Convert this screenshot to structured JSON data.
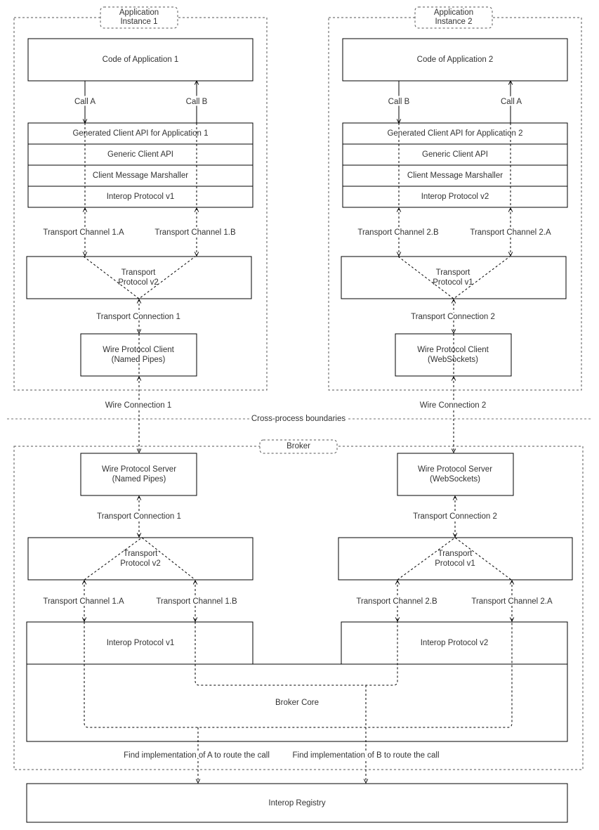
{
  "app1": {
    "group_label": [
      "Application",
      "Instance 1"
    ],
    "code": "Code of Application 1",
    "call_down": "Call A",
    "call_up": "Call B",
    "stack": [
      "Generated Client API for Application 1",
      "Generic Client API",
      "Client Message Marshaller",
      "Interop Protocol v1"
    ],
    "channel_left": "Transport Channel 1.A",
    "channel_right": "Transport Channel 1.B",
    "transport": [
      "Transport",
      "Protocol v2"
    ],
    "connection": "Transport Connection 1",
    "wire_client": [
      "Wire Protocol Client",
      "(Named Pipes)"
    ],
    "wire_connection": "Wire Connection 1"
  },
  "app2": {
    "group_label": [
      "Application",
      "Instance 2"
    ],
    "code": "Code of Application 2",
    "call_down": "Call B",
    "call_up": "Call A",
    "stack": [
      "Generated Client API for Application 2",
      "Generic Client API",
      "Client Message Marshaller",
      "Interop Protocol v2"
    ],
    "channel_left": "Transport Channel 2.B",
    "channel_right": "Transport Channel 2.A",
    "transport": [
      "Transport",
      "Protocol v1"
    ],
    "connection": "Transport Connection 2",
    "wire_client": [
      "Wire Protocol Client",
      "(WebSockets)"
    ],
    "wire_connection": "Wire Connection 2"
  },
  "boundary_label": "Cross-process boundaries",
  "broker": {
    "group_label": "Broker",
    "left": {
      "wire_server": [
        "Wire Protocol Server",
        "(Named Pipes)"
      ],
      "connection": "Transport Connection 1",
      "transport": [
        "Transport",
        "Protocol v2"
      ],
      "channel_left": "Transport Channel 1.A",
      "channel_right": "Transport Channel 1.B",
      "interop": "Interop Protocol v1"
    },
    "right": {
      "wire_server": [
        "Wire Protocol Server",
        "(WebSockets)"
      ],
      "connection": "Transport Connection 2",
      "transport": [
        "Transport",
        "Protocol v1"
      ],
      "channel_left": "Transport Channel 2.B",
      "channel_right": "Transport Channel 2.A",
      "interop": "Interop Protocol v2"
    },
    "core": "Broker Core",
    "find_a": "Find implementation of A to route the call",
    "find_b": "Find implementation of B to route the call"
  },
  "registry": "Interop Registry"
}
